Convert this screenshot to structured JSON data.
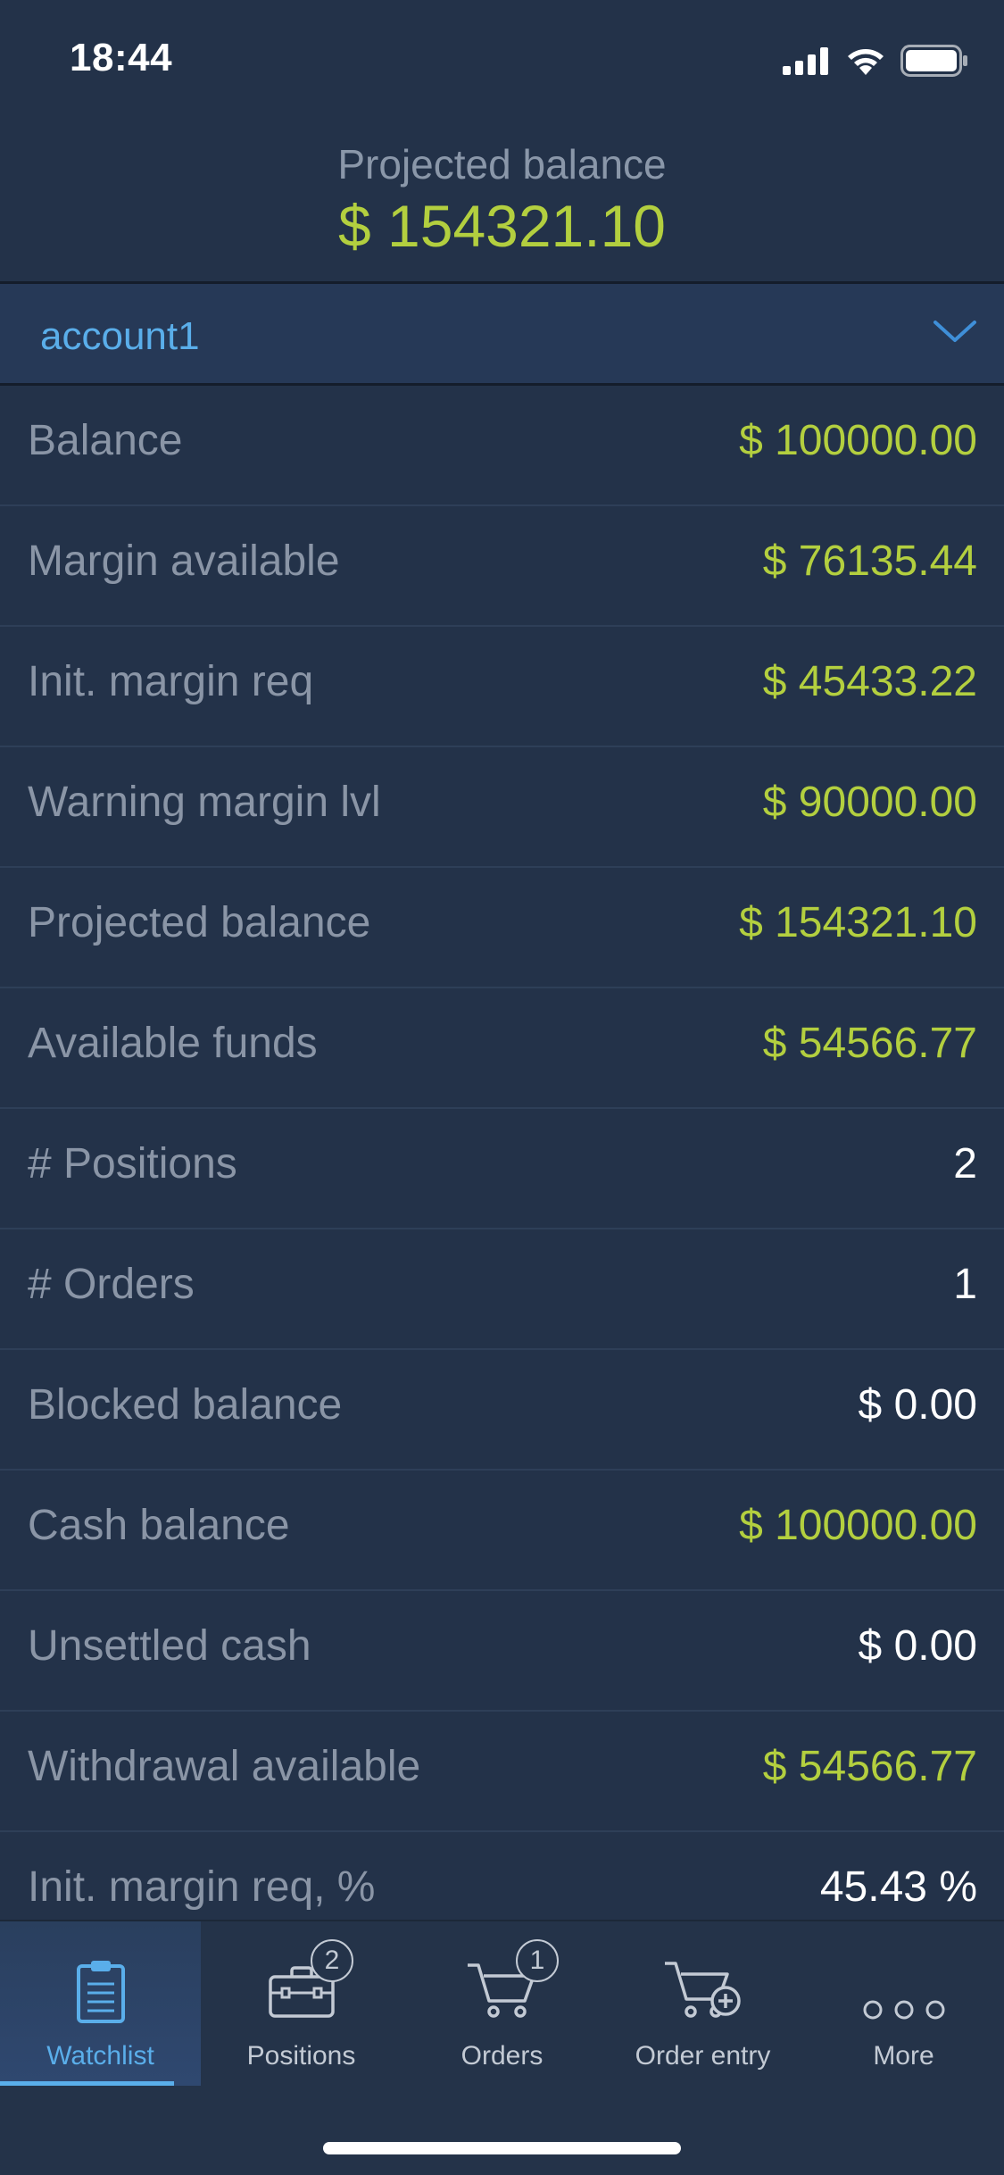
{
  "status_bar": {
    "time": "18:44"
  },
  "header": {
    "label": "Projected balance",
    "value": "$ 154321.10"
  },
  "account": {
    "name": "account1"
  },
  "rows": [
    {
      "label": "Balance",
      "value": "$ 100000.00",
      "color": "#b3cf3f"
    },
    {
      "label": "Margin available",
      "value": "$ 76135.44",
      "color": "#b3cf3f"
    },
    {
      "label": "Init. margin req",
      "value": "$ 45433.22",
      "color": "#b3cf3f"
    },
    {
      "label": "Warning margin lvl",
      "value": "$ 90000.00",
      "color": "#b3cf3f"
    },
    {
      "label": "Projected balance",
      "value": "$ 154321.10",
      "color": "#b3cf3f"
    },
    {
      "label": "Available funds",
      "value": "$ 54566.77",
      "color": "#b3cf3f"
    },
    {
      "label": "# Positions",
      "value": "2",
      "color": "#ffffff"
    },
    {
      "label": "# Orders",
      "value": "1",
      "color": "#ffffff"
    },
    {
      "label": "Blocked balance",
      "value": "$ 0.00",
      "color": "#ffffff"
    },
    {
      "label": "Cash balance",
      "value": "$ 100000.00",
      "color": "#b3cf3f"
    },
    {
      "label": "Unsettled cash",
      "value": "$ 0.00",
      "color": "#ffffff"
    },
    {
      "label": "Withdrawal available",
      "value": "$ 54566.77",
      "color": "#b3cf3f"
    },
    {
      "label": "Init. margin req, %",
      "value": "45.43 %",
      "color": "#ffffff"
    }
  ],
  "tabbar": {
    "tabs": [
      {
        "label": "Watchlist",
        "icon": "clipboard-icon",
        "active": true
      },
      {
        "label": "Positions",
        "icon": "briefcase-icon",
        "badge": "2"
      },
      {
        "label": "Orders",
        "icon": "cart-icon",
        "badge": "1"
      },
      {
        "label": "Order entry",
        "icon": "cart-plus-icon"
      },
      {
        "label": "More",
        "icon": "more-dots-icon"
      }
    ]
  },
  "colors": {
    "background": "#233249",
    "accent_blue": "#5aaeea",
    "positive_green": "#b3cf3f"
  }
}
